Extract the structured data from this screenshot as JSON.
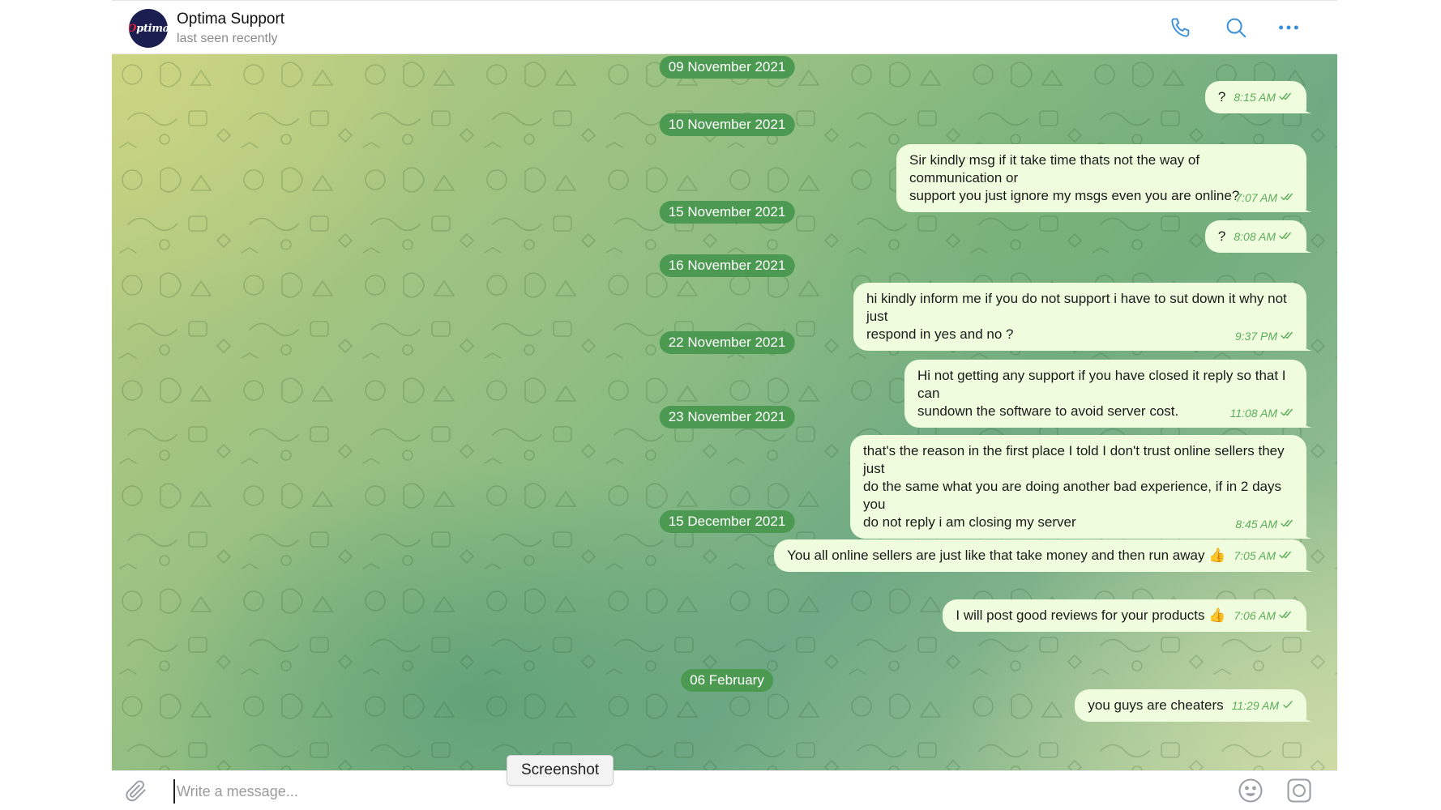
{
  "header": {
    "avatar_text": "Optima",
    "name": "Optima Support",
    "status": "last seen recently",
    "icons": [
      "phone-icon",
      "search-icon",
      "more-icon"
    ]
  },
  "colors": {
    "date_pill": "#4c9a52",
    "bubble_out": "#effdde",
    "meta_text": "#5dac5a",
    "avatar_bg": "#1b1f4f"
  },
  "messages": [
    {
      "type": "date",
      "text": "09 November 2021"
    },
    {
      "type": "msg",
      "text": "?",
      "time": "8:15 AM",
      "status": "read"
    },
    {
      "type": "date",
      "text": "10 November 2021"
    },
    {
      "type": "msg",
      "text": "Sir kindly msg if it take time thats not the way of communication or\nsupport you just ignore my msgs even you are online?",
      "time": "7:07 AM",
      "status": "read"
    },
    {
      "type": "date",
      "text": "15 November 2021"
    },
    {
      "type": "msg",
      "text": "?",
      "time": "8:08 AM",
      "status": "read"
    },
    {
      "type": "date",
      "text": "16 November 2021"
    },
    {
      "type": "msg",
      "text": "hi kindly inform me if you do not support i have to sut down it why not just\nrespond in yes and no ?",
      "time": "9:37 PM",
      "status": "read"
    },
    {
      "type": "date",
      "text": "22 November 2021"
    },
    {
      "type": "msg",
      "text": "Hi not getting any support if you have closed it reply so that I can\nsundown the software to avoid server cost.",
      "time": "11:08 AM",
      "status": "read"
    },
    {
      "type": "date",
      "text": "23 November 2021"
    },
    {
      "type": "msg",
      "text": "that's the reason in the first place I told I don't trust online sellers they just\ndo the same what you are doing another bad experience, if in 2 days you\ndo not reply i am closing my server",
      "time": "8:45 AM",
      "status": "read"
    },
    {
      "type": "date",
      "text": "15 December 2021"
    },
    {
      "type": "msg",
      "text": "You all online sellers are just like that take money and then run away 👍",
      "time": "7:05 AM",
      "status": "read"
    },
    {
      "type": "msg",
      "text": "I will post good reviews for your products 👍",
      "time": "7:06 AM",
      "status": "read"
    },
    {
      "type": "date",
      "text": "06 February"
    },
    {
      "type": "msg",
      "text": "you guys are cheaters",
      "time": "11:29 AM",
      "status": "sent"
    }
  ],
  "composer": {
    "placeholder": "Write a message...",
    "value": "",
    "screenshot_label": "Screenshot",
    "icons": [
      "paperclip-icon",
      "emoji-icon",
      "camera-icon"
    ]
  }
}
